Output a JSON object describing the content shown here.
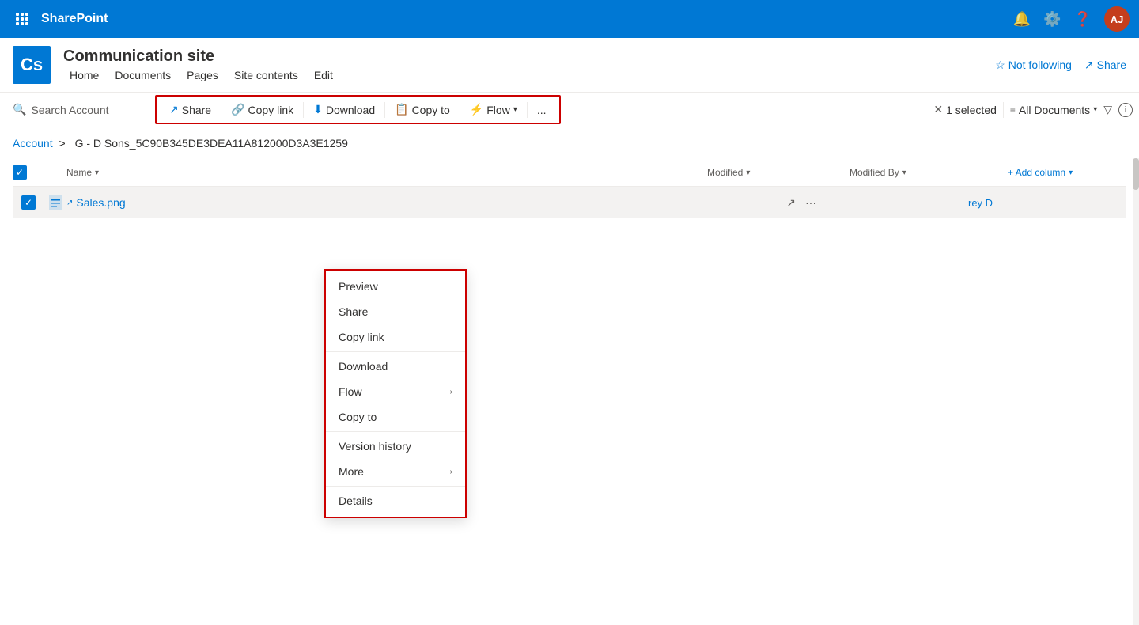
{
  "topbar": {
    "app_name": "SharePoint",
    "avatar_initials": "AJ"
  },
  "site": {
    "logo": "Cs",
    "title": "Communication site",
    "nav": [
      "Home",
      "Documents",
      "Pages",
      "Site contents",
      "Edit"
    ],
    "not_following": "Not following",
    "share": "Share"
  },
  "toolbar": {
    "search_placeholder": "Search Account",
    "share_label": "Share",
    "copy_link_label": "Copy link",
    "download_label": "Download",
    "copy_to_label": "Copy to",
    "flow_label": "Flow",
    "more_label": "...",
    "selected_label": "1 selected",
    "view_label": "All Documents",
    "close_selected": "×"
  },
  "breadcrumb": {
    "account": "Account",
    "separator": ">",
    "path": "G - D Sons_5C90B345DE3DEA11A812000D3A3E1259"
  },
  "columns": {
    "name": "Name",
    "modified": "Modified",
    "modified_by": "Modified By",
    "add_column": "+ Add column"
  },
  "files": [
    {
      "name": "Sales.png",
      "modified": "",
      "modified_by": "rey D"
    }
  ],
  "context_menu": {
    "items": [
      {
        "label": "Preview",
        "has_sub": false
      },
      {
        "label": "Share",
        "has_sub": false
      },
      {
        "label": "Copy link",
        "has_sub": false
      },
      {
        "label": "Download",
        "has_sub": false
      },
      {
        "label": "Flow",
        "has_sub": true
      },
      {
        "label": "Copy to",
        "has_sub": false
      },
      {
        "label": "Version history",
        "has_sub": false
      },
      {
        "label": "More",
        "has_sub": true
      },
      {
        "label": "Details",
        "has_sub": false
      }
    ]
  }
}
